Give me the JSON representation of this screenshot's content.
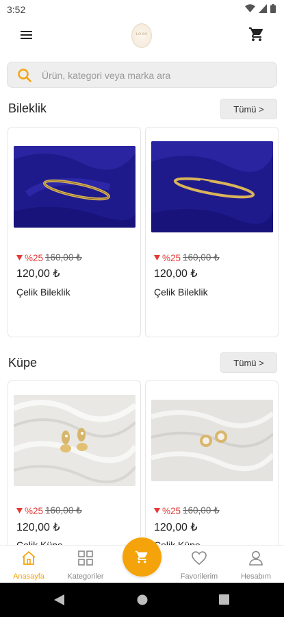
{
  "status_bar": {
    "time": "3:52"
  },
  "header": {
    "logo_text": "LOGO",
    "menu_icon": "hamburger-icon",
    "cart_icon": "cart-icon"
  },
  "search": {
    "placeholder": "Ürün, kategori veya marka ara",
    "icon": "search-icon"
  },
  "sections": [
    {
      "title": "Bileklik",
      "see_all": "Tümü >",
      "products": [
        {
          "discount": "%25",
          "old_price": "160,00 ₺",
          "price": "120,00 ₺",
          "name": "Çelik Bileklik"
        },
        {
          "discount": "%25",
          "old_price": "160,00 ₺",
          "price": "120,00 ₺",
          "name": "Çelik Bileklik"
        }
      ]
    },
    {
      "title": "Küpe",
      "see_all": "Tümü >",
      "products": [
        {
          "discount": "%25",
          "old_price": "160,00 ₺",
          "price": "120,00 ₺",
          "name": "Çelik Küpe"
        },
        {
          "discount": "%25",
          "old_price": "160,00 ₺",
          "price": "120,00 ₺",
          "name": "Çelik Küpe"
        }
      ]
    }
  ],
  "bottom_nav": {
    "items": [
      {
        "label": "Anasayfa",
        "icon": "home-icon",
        "active": true
      },
      {
        "label": "Kategoriler",
        "icon": "grid-icon",
        "active": false
      },
      {
        "label": "",
        "icon": "cart-icon",
        "active": false
      },
      {
        "label": "Favorilerim",
        "icon": "heart-icon",
        "active": false
      },
      {
        "label": "Hesabım",
        "icon": "user-icon",
        "active": false
      }
    ]
  },
  "colors": {
    "accent": "#f5a30a",
    "discount": "#e53935",
    "image_blue": "#1f1a8c",
    "image_white": "#e9e8e4"
  }
}
